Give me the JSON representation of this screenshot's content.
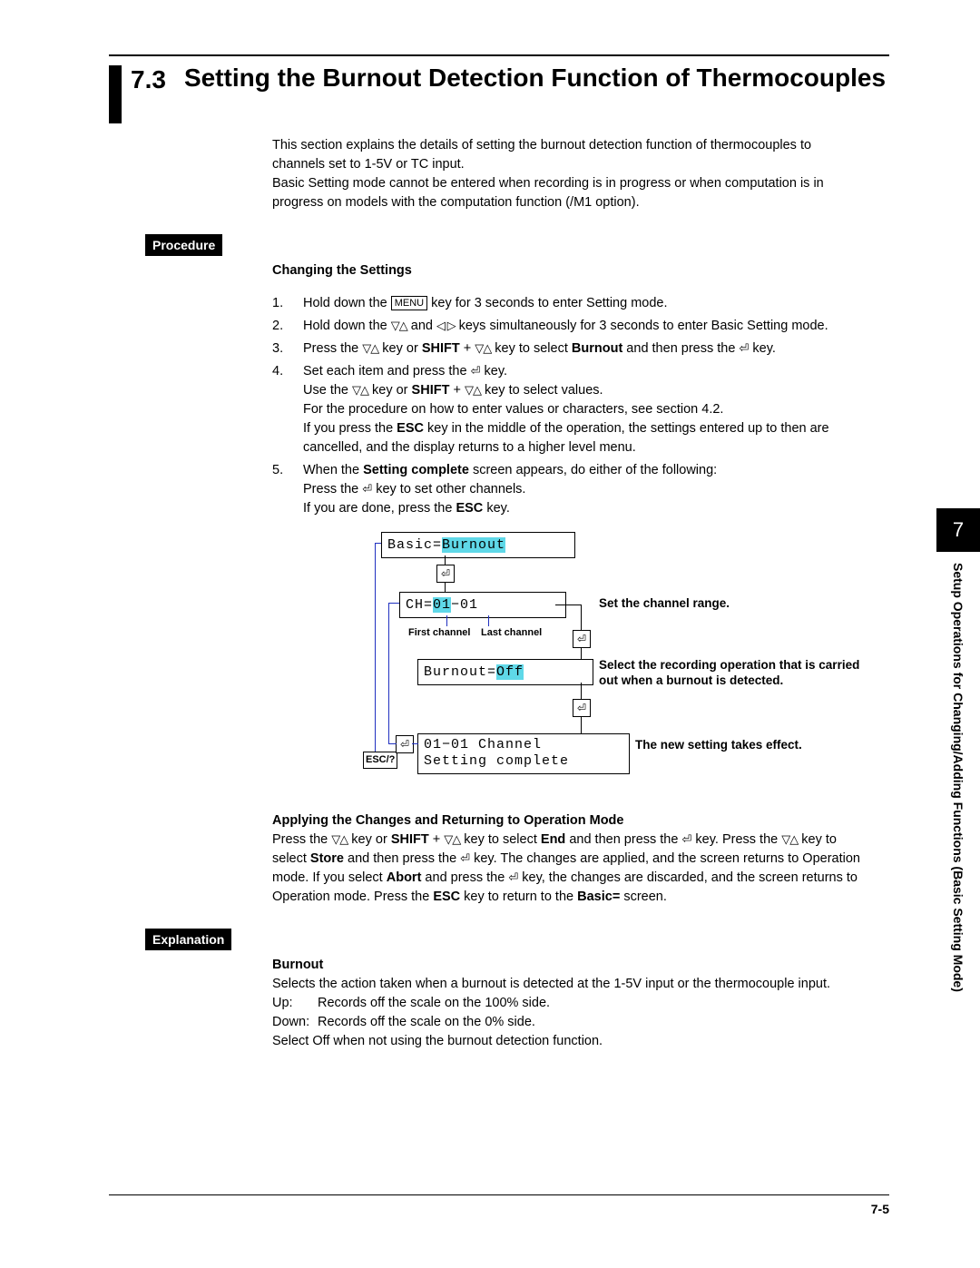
{
  "section": {
    "number": "7.3",
    "title": "Setting the Burnout Detection Function of Thermocouples"
  },
  "intro": {
    "p1": "This section explains the details of setting the burnout detection function of thermocouples to channels set to 1-5V or TC input.",
    "p2": "Basic Setting mode cannot be entered when recording is in progress or when computation is in progress on models with the computation function (/M1 option)."
  },
  "labels": {
    "procedure": "Procedure",
    "explanation": "Explanation"
  },
  "subhead1": "Changing the Settings",
  "keys": {
    "menu": "MENU",
    "esc": "ESC",
    "shift": "SHIFT",
    "burnout_word": "Burnout",
    "setting_complete": "Setting complete",
    "end": "End",
    "store": "Store",
    "abort": "Abort",
    "basic_eq": "Basic="
  },
  "steps": {
    "s1a": "Hold down the ",
    "s1b": " key for 3 seconds to enter Setting mode.",
    "s2a": "Hold down the ",
    "s2b": " and ",
    "s2c": " keys simultaneously for 3 seconds to enter Basic Setting mode.",
    "s3a": "Press the ",
    "s3b": " key or ",
    "s3c": " + ",
    "s3d": " key to select ",
    "s3e": " and then press the ",
    "s3f": " key.",
    "s4a": "Set each item and press the ",
    "s4b": " key.",
    "s4c": "Use the ",
    "s4d": " key or ",
    "s4e": " + ",
    "s4f": " key to select values.",
    "s4g": "For the procedure on how to enter values or characters, see section 4.2.",
    "s4h": "If you press the ",
    "s4i": " key in the middle of the operation, the settings entered up to then are cancelled, and the display returns to a higher level menu.",
    "s5a": "When the ",
    "s5b": " screen appears, do either of the following:",
    "s5c": "Press the ",
    "s5d": " key to set other channels.",
    "s5e": "If you are done, press the ",
    "s5f": " key."
  },
  "diagram": {
    "box1_prefix": "Basic=",
    "box1_hl": "Burnout",
    "box2_prefix": "CH=",
    "box2_hl": "01",
    "box2_suffix": "−01",
    "box3_prefix": "Burnout=",
    "box3_hl": "Off",
    "box4_line1": "01−01 Channel",
    "box4_line2": "Setting complete",
    "first_channel": "First channel",
    "last_channel": "Last channel",
    "note1": "Set the channel range.",
    "note2": "Select the recording operation that is carried out when a burnout is detected.",
    "note3": "The new setting takes effect.",
    "esc_label": "ESC/?"
  },
  "applying": {
    "head": "Applying the Changes and Returning to Operation Mode",
    "t1": "Press the ",
    "t2": " key or ",
    "t3": " + ",
    "t4": " key to select ",
    "t5": " and then press the ",
    "t6": " key.  Press the ",
    "t7": " key to select ",
    "t8": " and then press the ",
    "t9": " key.  The changes are applied, and the screen returns to Operation mode.  If you select ",
    "t10": " and press the ",
    "t11": " key, the changes are discarded, and the screen returns to Operation mode.  Press the ",
    "t12": " key to return to the ",
    "t13": " screen."
  },
  "explanation": {
    "head": "Burnout",
    "p1": "Selects the action taken when a burnout is detected at the 1-5V input or the thermocouple input.",
    "up_label": "Up:",
    "up_text": "Records off the scale on the 100% side.",
    "down_label": "Down:",
    "down_text": "Records off the scale on the 0% side.",
    "p2": "Select Off when not using the burnout detection function."
  },
  "side": {
    "chapter": "7",
    "text": "Setup Operations for Changing/Adding Functions (Basic Setting Mode)"
  },
  "footer": {
    "page": "7-5"
  }
}
